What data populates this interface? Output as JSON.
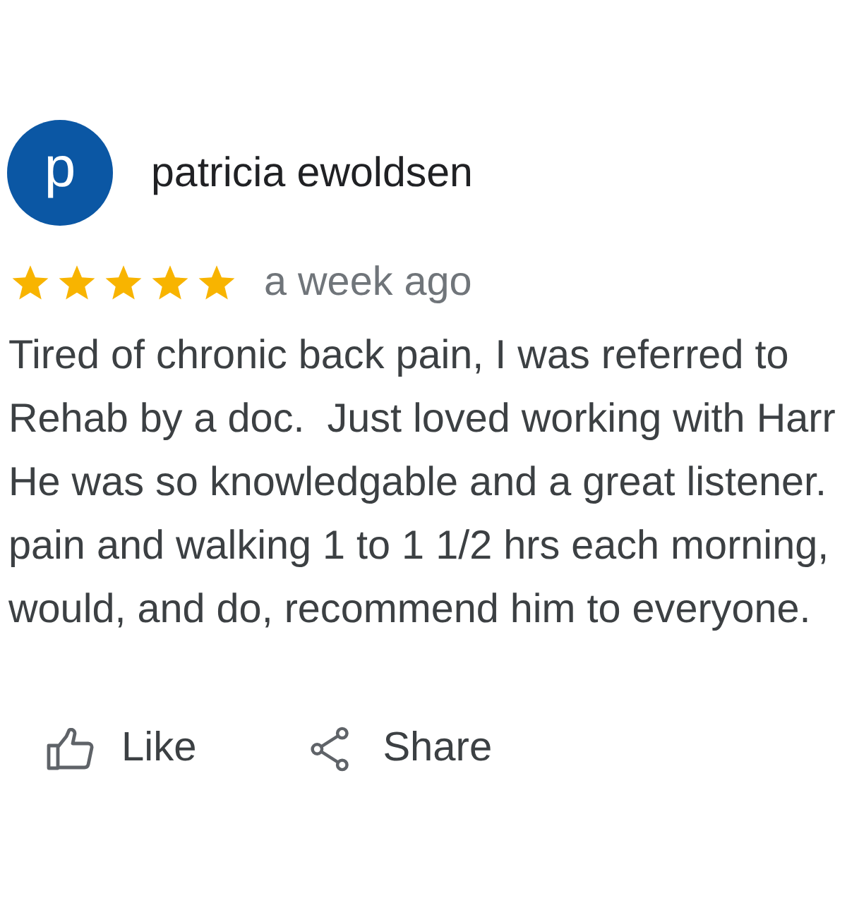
{
  "review": {
    "author": {
      "initial": "p",
      "name": "patricia ewoldsen"
    },
    "stars": 5,
    "time": "a week ago",
    "text_lines": [
      "Tired of chronic back pain, I was referred to",
      "Rehab by a doc.  Just loved working with Harr",
      "He was so knowledgable and a great listener.",
      "pain and walking 1 to 1 1/2 hrs each morning,",
      "would, and do, recommend him to everyone."
    ]
  },
  "actions": [
    {
      "kind": "like",
      "label": "Like"
    },
    {
      "kind": "share",
      "label": "Share"
    }
  ]
}
